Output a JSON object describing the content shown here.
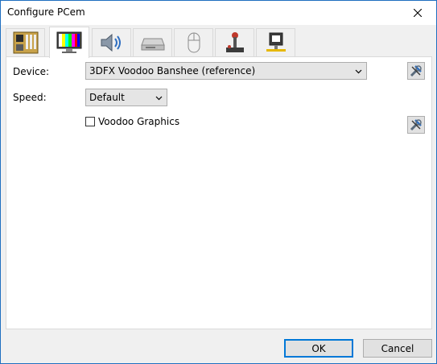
{
  "window": {
    "title": "Configure PCem"
  },
  "tabs": [
    {
      "name": "motherboard",
      "icon": "motherboard-icon",
      "active": false
    },
    {
      "name": "display",
      "icon": "monitor-icon",
      "active": true
    },
    {
      "name": "sound",
      "icon": "speaker-icon",
      "active": false
    },
    {
      "name": "storage",
      "icon": "drive-icon",
      "active": false
    },
    {
      "name": "mouse",
      "icon": "mouse-icon",
      "active": false
    },
    {
      "name": "joystick",
      "icon": "joystick-icon",
      "active": false
    },
    {
      "name": "network",
      "icon": "network-icon",
      "active": false
    }
  ],
  "display": {
    "device_label": "Device:",
    "device_value": "3DFX Voodoo Banshee (reference)",
    "speed_label": "Speed:",
    "speed_value": "Default",
    "voodoo_label": "Voodoo Graphics",
    "voodoo_checked": false
  },
  "buttons": {
    "ok": "OK",
    "cancel": "Cancel"
  },
  "colors": {
    "accent": "#0078d7",
    "button_bg": "#e1e1e1",
    "panel_bg": "#ffffff"
  }
}
